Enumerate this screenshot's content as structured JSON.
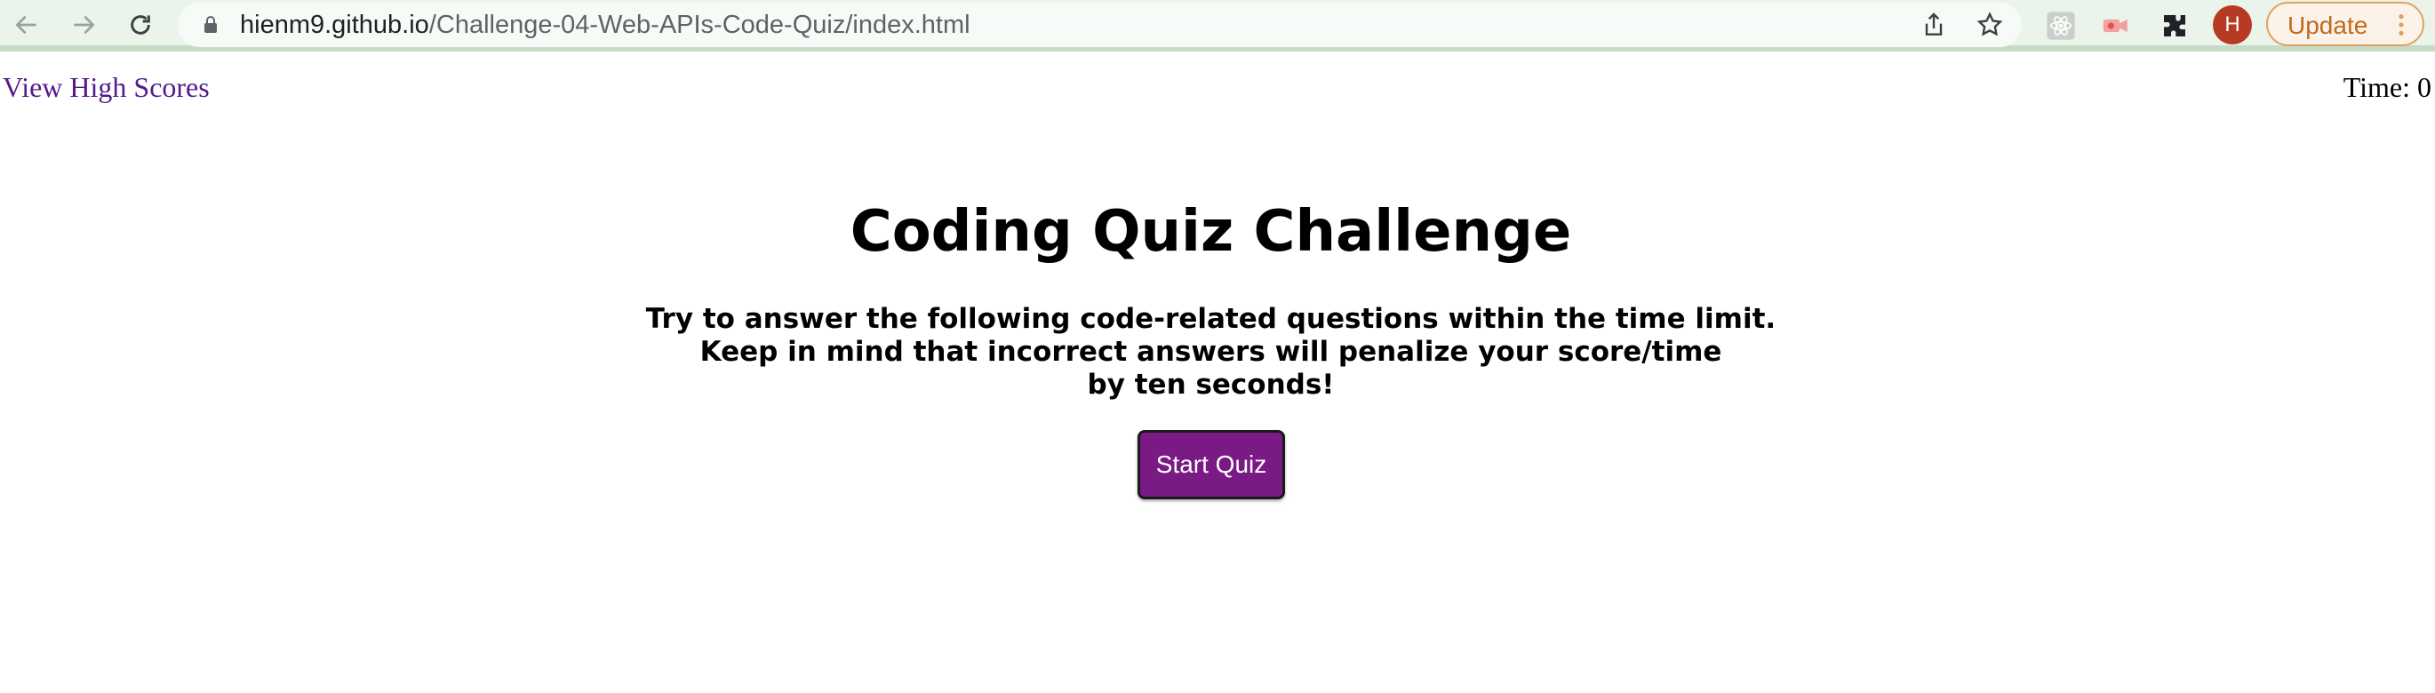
{
  "browser": {
    "url_host": "hienm9.github.io",
    "url_path": "/Challenge-04-Web-APIs-Code-Quiz/index.html",
    "profile_initial": "H",
    "update_label": "Update",
    "icons": [
      "back-arrow-icon",
      "forward-arrow-icon",
      "reload-icon",
      "lock-icon",
      "share-icon",
      "star-icon",
      "react-devtools-icon",
      "screen-recorder-icon",
      "puzzle-icon",
      "kebab-menu-icon"
    ]
  },
  "page": {
    "high_scores_link": "View High Scores",
    "timer_label": "Time: ",
    "timer_value": "0",
    "title": "Coding Quiz Challenge",
    "intro_lines": [
      "Try to answer the following code-related questions within the time limit.",
      "Keep in mind that incorrect answers will penalize your score/time",
      "by ten seconds!"
    ],
    "start_button": "Start Quiz"
  },
  "colors": {
    "toolbar_bg": "#eaf4ea",
    "link": "#551a8b",
    "button_bg": "#7a1a85",
    "update_accent": "#c26a1a",
    "avatar_bg": "#b73a23"
  }
}
